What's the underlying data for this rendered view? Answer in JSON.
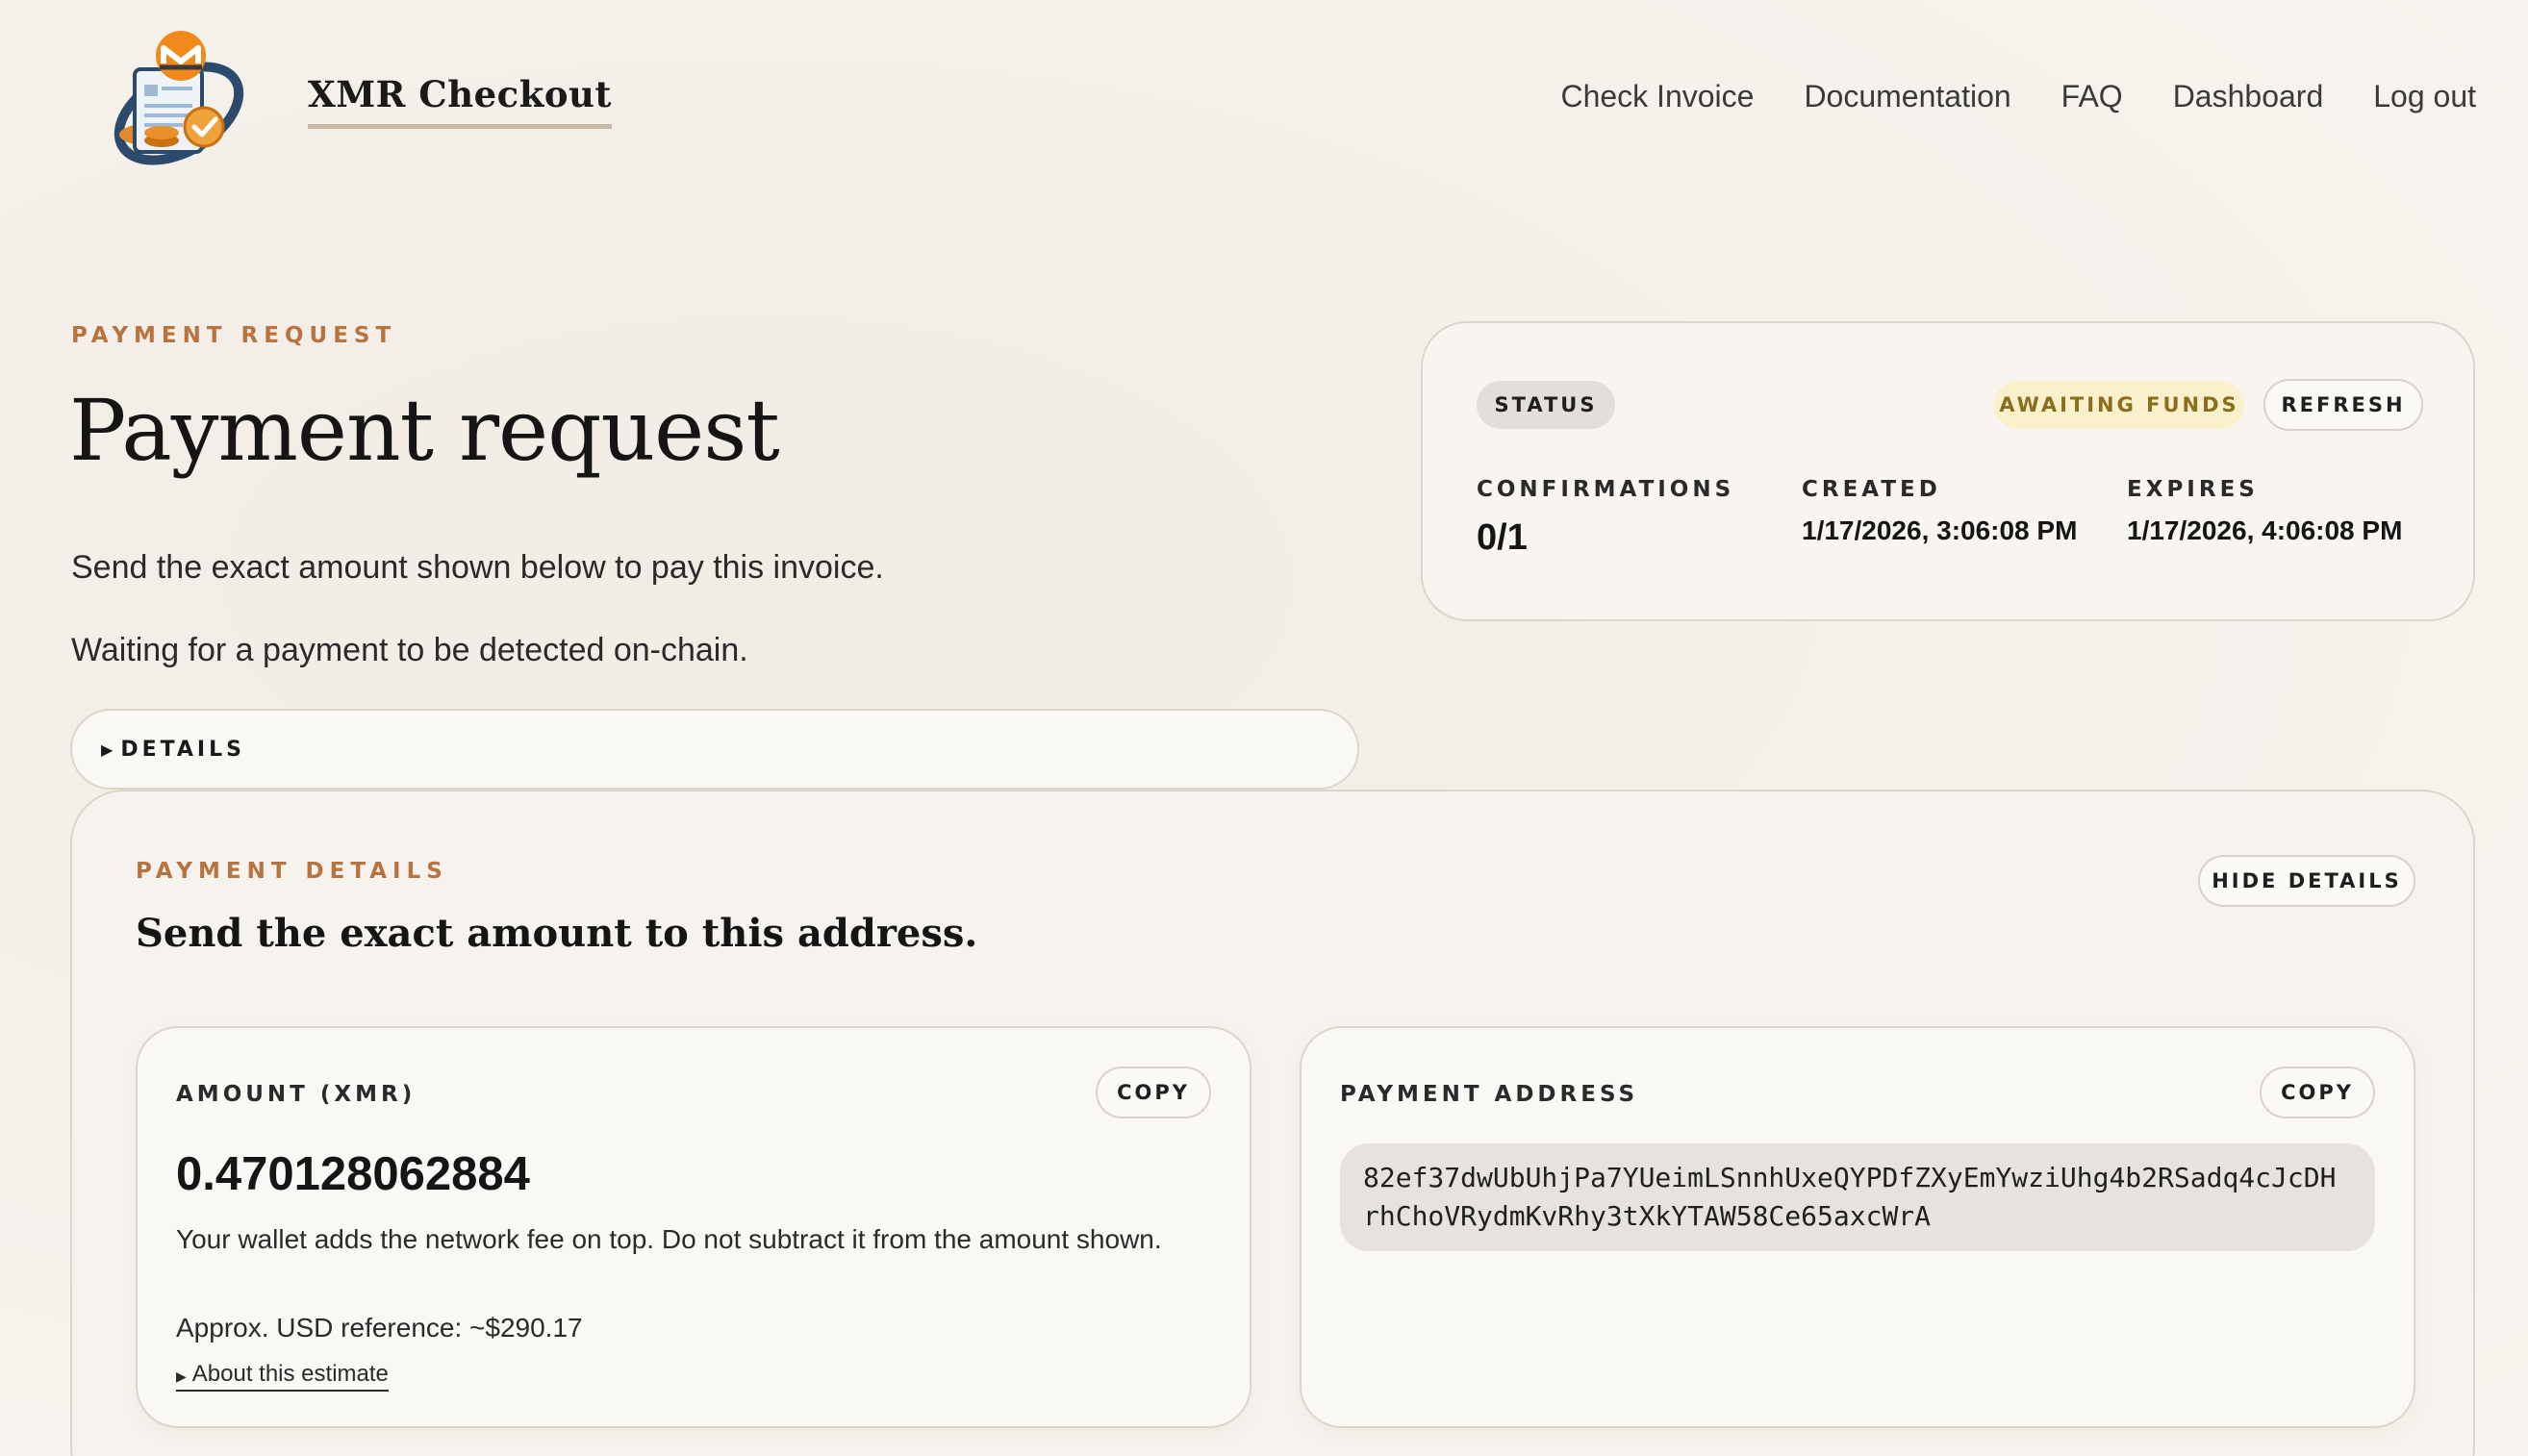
{
  "header": {
    "brand": "XMR Checkout",
    "logo_icon": "monero-invoice-logo-icon",
    "nav": [
      "Check Invoice",
      "Documentation",
      "FAQ",
      "Dashboard",
      "Log out"
    ]
  },
  "hero": {
    "eyebrow": "PAYMENT REQUEST",
    "title": "Payment request",
    "text1": "Send the exact amount shown below to pay this invoice.",
    "text2": "Waiting for a payment to be detected on-chain.",
    "details_label": "DETAILS"
  },
  "status_card": {
    "status_label": "STATUS",
    "status_value": "AWAITING FUNDS",
    "refresh_label": "REFRESH",
    "confirmations_label": "CONFIRMATIONS",
    "confirmations_value": "0/1",
    "created_label": "CREATED",
    "created_value": "1/17/2026, 3:06:08 PM",
    "expires_label": "EXPIRES",
    "expires_value": "1/17/2026, 4:06:08 PM"
  },
  "payment_details": {
    "eyebrow": "PAYMENT DETAILS",
    "title": "Send the exact amount to this address.",
    "hide_label": "HIDE DETAILS",
    "amount": {
      "label": "AMOUNT (XMR)",
      "copy_label": "COPY",
      "value": "0.470128062884",
      "note": "Your wallet adds the network fee on top. Do not subtract it from the amount shown.",
      "usd_reference": "Approx. USD reference: ~$290.17",
      "about_label": "About this estimate"
    },
    "address": {
      "label": "PAYMENT ADDRESS",
      "copy_label": "COPY",
      "value": "82ef37dwUbUhjPa7YUeimLSnnhUxeQYPDfZXyEmYwziUhg4b2RSadq4cJcDHrhChoVRydmKvRhy3tXkYTAW58Ce65axcWrA"
    }
  },
  "colors": {
    "accent": "#b8733f",
    "awaiting_bg": "#fbf0cc",
    "awaiting_text": "#8a6d1d",
    "background": "#f4f0ea"
  }
}
